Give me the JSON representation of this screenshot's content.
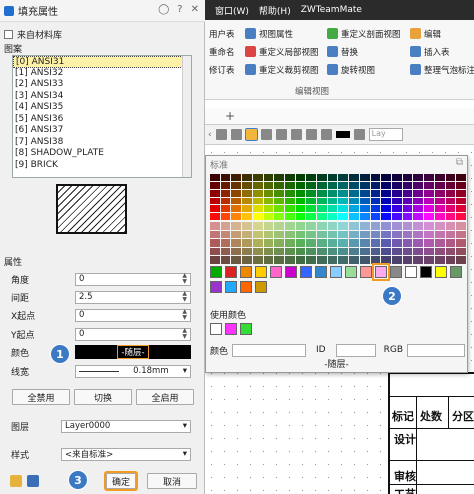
{
  "menubar": {
    "items": [
      "窗口(W)",
      "帮助(H)",
      "ZWTeamMate"
    ]
  },
  "ribbon": {
    "col1": [
      "用户表",
      "重命名",
      "修订表"
    ],
    "col2": [
      "视图属性",
      "重定义局部视图",
      "重定义裁剪视图"
    ],
    "col3": [
      "重定义剖面视图",
      "替换",
      "旋转视图"
    ],
    "col4": [
      "编辑",
      "插入表",
      "整理气泡标注"
    ],
    "group_label": "编辑视图"
  },
  "toolbar2": {
    "layer_placeholder": "Lay"
  },
  "dialog": {
    "title": "填充属性",
    "from_library_label": "来自材料库",
    "pattern_section": "图案",
    "patterns": [
      "[0] ANSI31",
      "[1] ANSI32",
      "[2] ANSI33",
      "[3] ANSI34",
      "[4] ANSI35",
      "[5] ANSI36",
      "[6] ANSI37",
      "[7] ANSI38",
      "[8] SHADOW_PLATE",
      "[9] BRICK"
    ],
    "selected_pattern_index": 0,
    "props_section": "属性",
    "angle": {
      "label": "角度",
      "value": "0"
    },
    "spacing": {
      "label": "间距",
      "value": "2.5"
    },
    "x_origin": {
      "label": "X起点",
      "value": "0"
    },
    "y_origin": {
      "label": "Y起点",
      "value": "0"
    },
    "color": {
      "label": "颜色",
      "value": "-随层-",
      "swatch": "#000000"
    },
    "linewidth": {
      "label": "线宽",
      "value": "0.18mm"
    },
    "btn_disable_all": "全禁用",
    "btn_toggle": "切换",
    "btn_enable_all": "全启用",
    "layer": {
      "label": "图层",
      "value": "Layer0000"
    },
    "style": {
      "label": "样式",
      "value": "<来自标准>"
    },
    "ok": "确定",
    "cancel": "取消"
  },
  "color_popup": {
    "title": "标准",
    "used_colors_label": "使用颜色",
    "color_label": "颜色",
    "id_label": "ID",
    "rgb_label": "RGB",
    "footer": "-随层-",
    "basic_colors": [
      "#00aa00",
      "#dd2222",
      "#ee8800",
      "#ffcc00",
      "#ff66cc",
      "#cc00cc",
      "#3366ff",
      "#3388cc",
      "#88ccff",
      "#99dd99",
      "#ff9999",
      "#ffaaee",
      "#888888",
      "#ffffff",
      "#000000",
      "#ffff00",
      "#669966",
      "#9933cc",
      "#22aaff",
      "#ff6600",
      "#cc9900"
    ],
    "selected_basic_index": 11,
    "used_colors": [
      "#ffffff",
      "#ff33ff",
      "#33dd33"
    ]
  },
  "title_block": {
    "r1": [
      "标记",
      "处数",
      "分区"
    ],
    "r2": "设计",
    "r3": "审核",
    "r4": "工艺"
  },
  "badges": [
    "1",
    "2",
    "3"
  ]
}
